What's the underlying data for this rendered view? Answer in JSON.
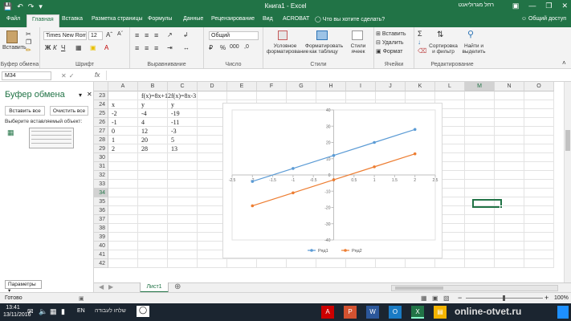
{
  "titlebar": {
    "title": "Книга1 - Excel",
    "user": "רחל מגרוליאנט",
    "qat_icons": [
      "save-icon",
      "undo-icon",
      "redo-icon"
    ],
    "window_buttons": [
      "minimize",
      "restore",
      "close"
    ]
  },
  "tabs": [
    {
      "label": "Файл",
      "active": false
    },
    {
      "label": "Главная",
      "active": true
    },
    {
      "label": "Вставка",
      "active": false
    },
    {
      "label": "Разметка страницы",
      "active": false
    },
    {
      "label": "Формулы",
      "active": false
    },
    {
      "label": "Данные",
      "active": false
    },
    {
      "label": "Рецензирование",
      "active": false
    },
    {
      "label": "Вид",
      "active": false
    },
    {
      "label": "ACROBAT",
      "active": false
    }
  ],
  "tell_me": "Что вы хотите сделать?",
  "share": "Общий доступ",
  "ribbon": {
    "clipboard": {
      "paste": "Вставить",
      "label": "Буфер обмена"
    },
    "font": {
      "name": "Times New Roma",
      "size": "12",
      "label": "Шрифт"
    },
    "align": {
      "label": "Выравнивание"
    },
    "number": {
      "format": "Общий",
      "label": "Число"
    },
    "styles": {
      "cond": "Условное форматирование",
      "table": "Форматировать как таблицу",
      "cell": "Стили ячеек",
      "label": "Стили"
    },
    "cells": {
      "insert": "Вставить",
      "delete": "Удалить",
      "format": "Формат",
      "label": "Ячейки"
    },
    "editing": {
      "sort": "Сортировка и фильтр",
      "find": "Найти и выделить",
      "label": "Редактирование"
    }
  },
  "namebox": "M34",
  "fx": "fx",
  "clipboard_pane": {
    "title": "Буфер обмена",
    "paste_all": "Вставить все",
    "clear_all": "Очистить все",
    "hint": "Выберите вставляемый объект:",
    "params": "Параметры"
  },
  "columns": [
    "A",
    "B",
    "C",
    "D",
    "E",
    "F",
    "G",
    "H",
    "I",
    "J",
    "K",
    "L",
    "M",
    "N",
    "O"
  ],
  "selected_column": "M",
  "rows": [
    23,
    24,
    25,
    26,
    27,
    28,
    29,
    30,
    31,
    32,
    33,
    34,
    35,
    36,
    37,
    38,
    39,
    40,
    41,
    42
  ],
  "selected_row": 34,
  "cells": {
    "B23": "f(x)=8x+12",
    "C23": "f(x)=8x-3",
    "A24": "x",
    "B24": "y",
    "C24": "y",
    "A25": "-2",
    "B25": "-4",
    "C25": "-19",
    "A26": "-1",
    "B26": "4",
    "C26": "-11",
    "A27": "0",
    "B27": "12",
    "C27": "-3",
    "A28": "1",
    "B28": "20",
    "C28": "5",
    "A29": "2",
    "B29": "28",
    "C29": "13"
  },
  "chart_data": {
    "type": "line",
    "x": [
      -2,
      -1,
      0,
      1,
      2
    ],
    "series": [
      {
        "name": "Ряд1",
        "values": [
          -4,
          4,
          12,
          20,
          28
        ],
        "color": "#5b9bd5"
      },
      {
        "name": "Ряд2",
        "values": [
          -19,
          -11,
          -3,
          5,
          13
        ],
        "color": "#ed7d31"
      }
    ],
    "xlim": [
      -2.5,
      2.5
    ],
    "ylim": [
      -40,
      40
    ],
    "xticks": [
      "-2.5",
      "-2",
      "-1.5",
      "-1",
      "-0.5",
      "0",
      "0.5",
      "1",
      "1.5",
      "2",
      "2.5"
    ],
    "yticks": [
      "40",
      "30",
      "20",
      "10",
      "0",
      "-10",
      "-20",
      "-30",
      "-40"
    ],
    "legend": "bottom",
    "grid": false
  },
  "sheet": {
    "name": "Лист1"
  },
  "status": {
    "ready": "Готово",
    "zoom": "100%"
  },
  "taskbar": {
    "lang": "EN",
    "time": "13:41",
    "date": "13/11/2016",
    "search": "שלחו לעבודה",
    "watermark": "online-otvet.ru"
  }
}
